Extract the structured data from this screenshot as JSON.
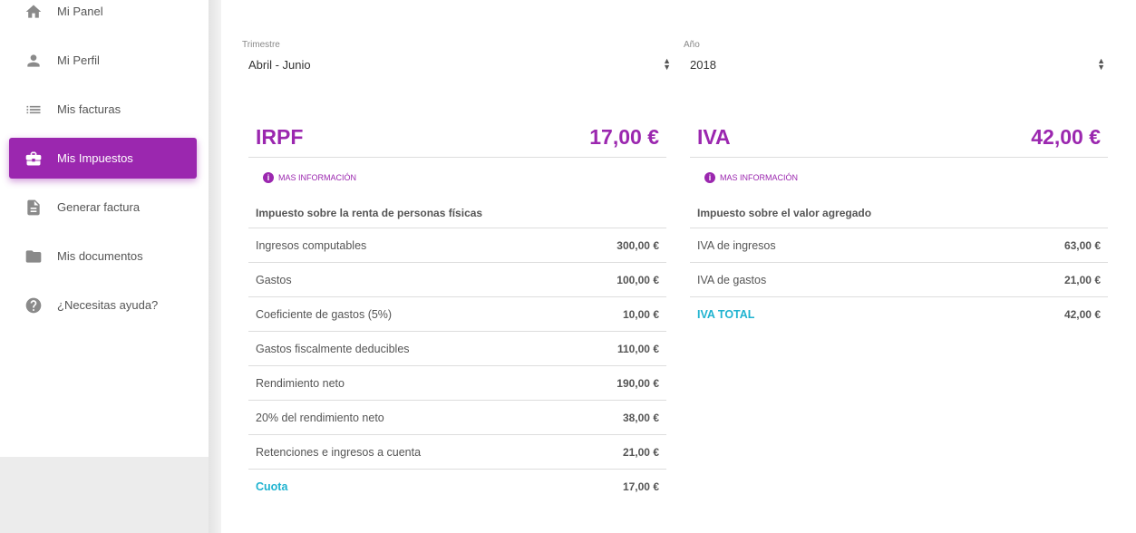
{
  "sidebar": {
    "items": [
      {
        "label": "Mi Panel",
        "icon": "home-icon"
      },
      {
        "label": "Mi Perfil",
        "icon": "person-icon"
      },
      {
        "label": "Mis facturas",
        "icon": "list-icon"
      },
      {
        "label": "Mis Impuestos",
        "icon": "briefcase-icon",
        "active": true
      },
      {
        "label": "Generar factura",
        "icon": "document-icon"
      },
      {
        "label": "Mis documentos",
        "icon": "folder-icon"
      },
      {
        "label": "¿Necesitas ayuda?",
        "icon": "help-icon"
      }
    ]
  },
  "filters": {
    "quarter": {
      "label": "Trimestre",
      "value": "Abril - Junio"
    },
    "year": {
      "label": "Año",
      "value": "2018"
    }
  },
  "irpf": {
    "title": "IRPF",
    "amount": "17,00 €",
    "info": "MAS INFORMACIÓN",
    "subtitle": "Impuesto sobre la renta de personas físicas",
    "rows": [
      {
        "label": "Ingresos computables",
        "value": "300,00 €"
      },
      {
        "label": "Gastos",
        "value": "100,00 €"
      },
      {
        "label": "Coeficiente de gastos (5%)",
        "value": "10,00 €"
      },
      {
        "label": "Gastos fiscalmente deducibles",
        "value": "110,00 €"
      },
      {
        "label": "Rendimiento neto",
        "value": "190,00 €"
      },
      {
        "label": "20% del rendimiento neto",
        "value": "38,00 €"
      },
      {
        "label": "Retenciones e ingresos a cuenta",
        "value": "21,00 €"
      },
      {
        "label": "Cuota",
        "value": "17,00 €"
      }
    ]
  },
  "iva": {
    "title": "IVA",
    "amount": "42,00 €",
    "info": "MAS INFORMACIÓN",
    "subtitle": "Impuesto sobre el valor agregado",
    "rows": [
      {
        "label": "IVA de ingresos",
        "value": "63,00 €"
      },
      {
        "label": "IVA de gastos",
        "value": "21,00 €"
      },
      {
        "label": "IVA TOTAL",
        "value": "42,00 €"
      }
    ]
  },
  "colors": {
    "accent": "#9b27af",
    "total": "#1fb3d0"
  }
}
